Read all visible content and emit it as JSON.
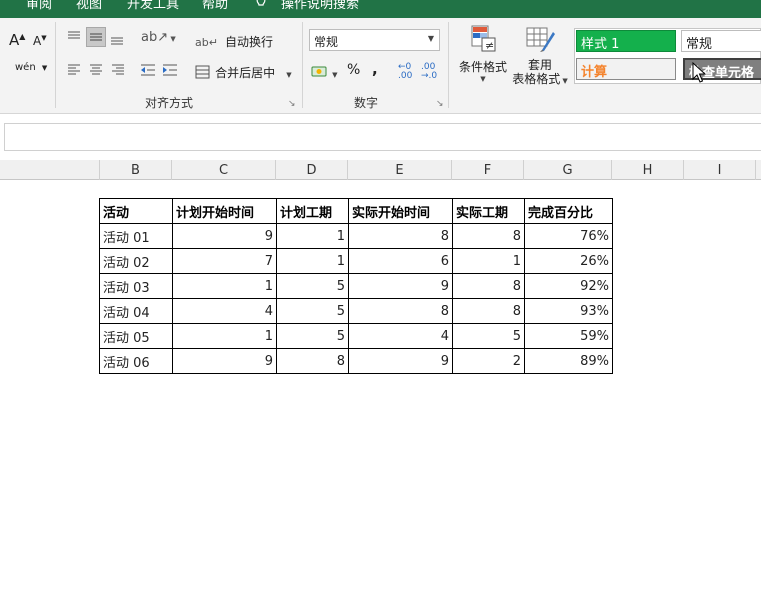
{
  "ribbon_tabs": [
    "审阅",
    "视图",
    "开发工具",
    "帮助",
    "操作说明搜索"
  ],
  "font_group": {
    "increase_font": "A",
    "decrease_font": "A",
    "phonetic": "wén"
  },
  "alignment_group": {
    "wrap_text_label": "自动换行",
    "merge_center_label": "合并后居中",
    "group_label": "对齐方式"
  },
  "number_group": {
    "format_value": "常规",
    "percent_symbol": "%",
    "comma_symbol": ",",
    "group_label": "数字"
  },
  "styles_group": {
    "conditional_format_label": "条件格式",
    "table_format_label_line1": "套用",
    "table_format_label_line2": "表格格式",
    "style1_label": "样式 1",
    "normal_label": "常规",
    "calc_label": "计算",
    "check_cell_label": "检查单元格",
    "style1_color": "#14b04c",
    "calc_color": "#f5832c",
    "check_cell_color": "#7f7f7f"
  },
  "columns": [
    "B",
    "C",
    "D",
    "E",
    "F",
    "G",
    "H",
    "I"
  ],
  "table": {
    "headers": [
      "活动",
      "计划开始时间",
      "计划工期",
      "实际开始时间",
      "实际工期",
      "完成百分比"
    ],
    "rows": [
      [
        "活动 01",
        "9",
        "1",
        "8",
        "8",
        "76%"
      ],
      [
        "活动 02",
        "7",
        "1",
        "6",
        "1",
        "26%"
      ],
      [
        "活动 03",
        "1",
        "5",
        "9",
        "8",
        "92%"
      ],
      [
        "活动 04",
        "4",
        "5",
        "8",
        "8",
        "93%"
      ],
      [
        "活动 05",
        "1",
        "5",
        "4",
        "5",
        "59%"
      ],
      [
        "活动 06",
        "9",
        "8",
        "9",
        "2",
        "89%"
      ]
    ]
  },
  "accent_color": "#217346"
}
